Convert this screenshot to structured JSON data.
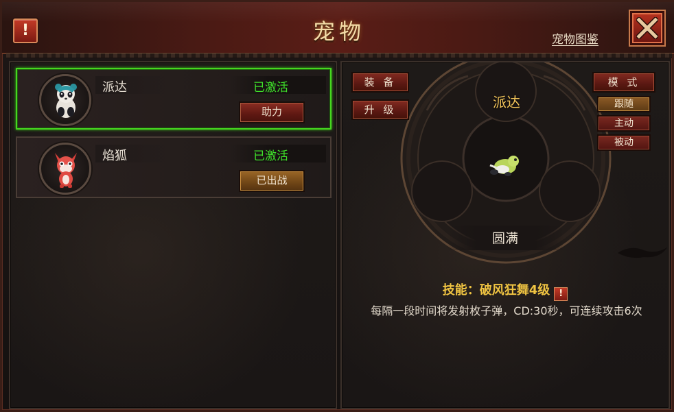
{
  "header": {
    "title": "宠物",
    "pokedex_link": "宠物图鉴",
    "alert_glyph": "!"
  },
  "pets": [
    {
      "name": "派达",
      "status": "已激活",
      "action": "助力",
      "selected": true
    },
    {
      "name": "焰狐",
      "status": "已激活",
      "action": "已出战",
      "selected": false
    }
  ],
  "detail": {
    "equip_button": "装 备",
    "upgrade_button": "升 级",
    "mode_button": "模 式",
    "mode_options": [
      "跟随",
      "主动",
      "被动"
    ],
    "active_mode": "跟随",
    "pet_name": "派达",
    "grade": "圆满",
    "skill_title": "技能：破风狂舞4级",
    "skill_alert": "!",
    "skill_description": "每隔一段时间将发射枚子弹，CD:30秒，可连续攻击6次"
  },
  "colors": {
    "active_status": "#3fe12a",
    "selected_border": "#46d81f",
    "skill_text": "#f0c442",
    "title_text": "#f4dca8"
  },
  "icons": {
    "alert": "alert-icon",
    "close": "close-x-icon",
    "panda_pet": "panda-pet-icon",
    "fox_pet": "fox-pet-icon"
  }
}
